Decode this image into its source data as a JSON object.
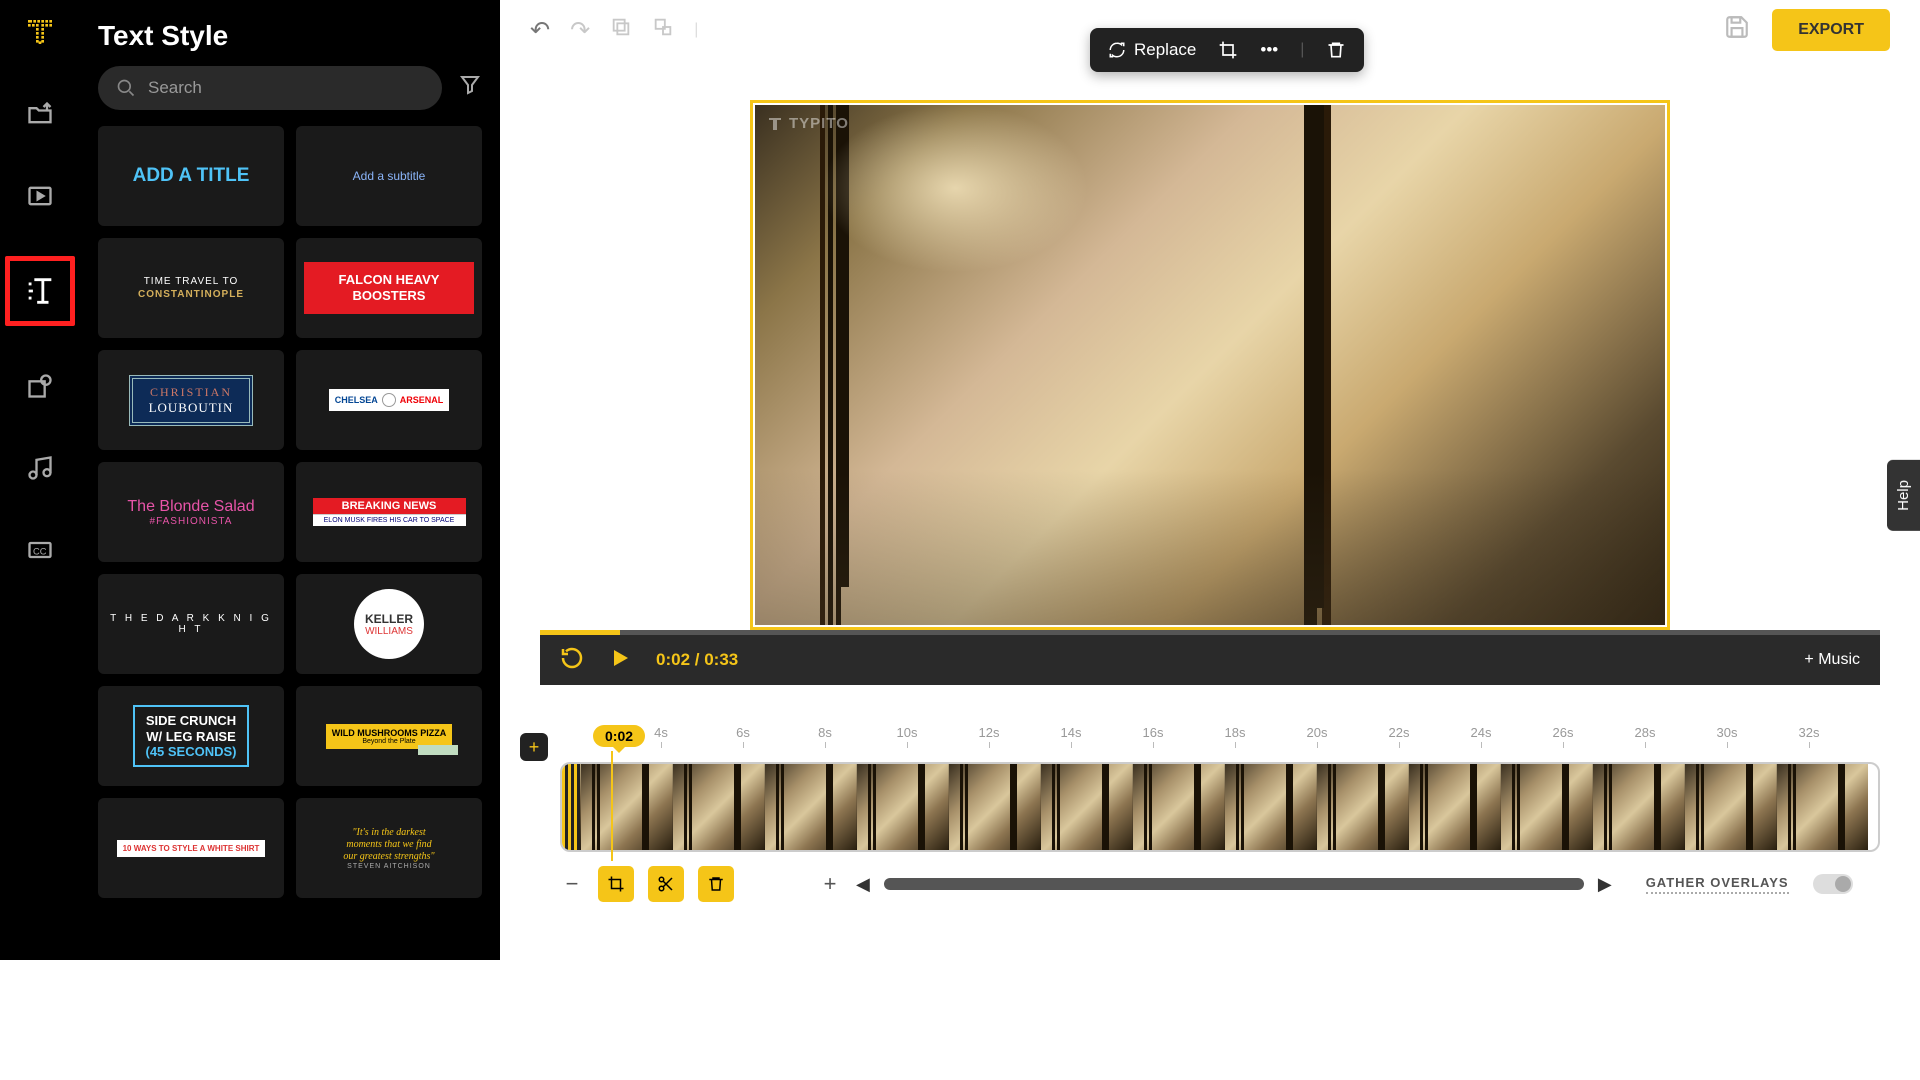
{
  "panel": {
    "title": "Text Style",
    "search_placeholder": "Search"
  },
  "leftnav": [
    "logo",
    "import",
    "templates",
    "text",
    "shapes",
    "music",
    "captions"
  ],
  "cards": [
    {
      "id": "add-title",
      "text": "ADD A TITLE"
    },
    {
      "id": "add-subtitle",
      "text": "Add a subtitle"
    },
    {
      "id": "time-travel",
      "l1": "TIME TRAVEL TO",
      "l2": "CONSTANTINOPLE"
    },
    {
      "id": "falcon",
      "text": "FALCON HEAVY BOOSTERS"
    },
    {
      "id": "louboutin",
      "l1": "CHRISTIAN",
      "l2": "LOUBOUTIN"
    },
    {
      "id": "chelsea",
      "l1": "CHELSEA",
      "l2": "ARSENAL"
    },
    {
      "id": "blonde",
      "l1": "The Blonde Salad",
      "l2": "#FASHIONISTA"
    },
    {
      "id": "breaking",
      "l1": "BREAKING NEWS",
      "l2": "ELON MUSK FIRES HIS CAR TO SPACE"
    },
    {
      "id": "dark-knight",
      "text": "T H E   D A R K   K N I G H T"
    },
    {
      "id": "keller",
      "l1": "KELLER",
      "l2": "WILLIAMS"
    },
    {
      "id": "crunch",
      "l1": "SIDE CRUNCH",
      "l2": "W/ LEG RAISE",
      "l3": "(45 SECONDS)"
    },
    {
      "id": "mushrooms",
      "l1": "WILD MUSHROOMS PIZZA",
      "l2": "Beyond the Plate"
    },
    {
      "id": "ghost",
      "text": "10 WAYS TO STYLE A WHITE SHIRT"
    },
    {
      "id": "quote",
      "l1": "\"It's in the darkest",
      "l2": "moments that we find",
      "l3": "our greatest strengths\"",
      "author": "STEVEN AITCHISON"
    }
  ],
  "floatbar": {
    "replace": "Replace"
  },
  "topbar": {
    "export": "EXPORT"
  },
  "preview": {
    "watermark": "TYPITO"
  },
  "player": {
    "current": "0:02",
    "total": "0:33",
    "music": "+ Music"
  },
  "timeline": {
    "playhead": "0:02",
    "ticks": [
      "4s",
      "6s",
      "8s",
      "10s",
      "12s",
      "14s",
      "16s",
      "18s",
      "20s",
      "22s",
      "24s",
      "26s",
      "28s",
      "30s",
      "32s"
    ],
    "overlays_label": "GATHER OVERLAYS"
  },
  "help": "Help"
}
